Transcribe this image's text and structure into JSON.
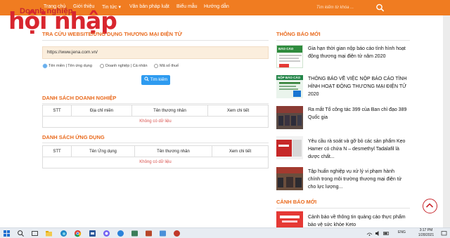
{
  "logo": {
    "tagline": "Doanh nghiệp",
    "name": "hội nhập"
  },
  "nav": {
    "items": [
      "Trang chủ",
      "Giới thiệu",
      "Tin tức",
      "Văn bản pháp luật",
      "Biểu mẫu",
      "Hướng dẫn"
    ],
    "tin_tuc_caret": "▾",
    "search_placeholder": "Tìm kiếm từ khóa ..."
  },
  "lookup": {
    "title": "TRA CỨU WEBSITE/ỨNG DỤNG THƯƠNG MẠI ĐIỆN TỬ",
    "url_value": "https://www.jena.com.vn/",
    "radios": [
      {
        "label": "Tên miền | Tên ứng dụng",
        "checked": true
      },
      {
        "label": "Doanh nghiệp | Cá nhân",
        "checked": false
      },
      {
        "label": "Mã số thuế",
        "checked": false
      }
    ],
    "search_button": "Tìm kiếm"
  },
  "enterprises": {
    "title": "DANH SÁCH DOANH NGHIỆP",
    "columns": [
      "STT",
      "Địa chỉ miền",
      "Tên thương nhân",
      "Xem chi tiết"
    ],
    "empty": "Không có dữ liệu"
  },
  "apps": {
    "title": "DANH SÁCH ỨNG DỤNG",
    "columns": [
      "STT",
      "Tên Ứng dụng",
      "Tên thương nhân",
      "Xem chi tiết"
    ],
    "empty": "Không có dữ liệu"
  },
  "sidebar": {
    "notices_title": "THÔNG BÁO MỚI",
    "news": [
      "Gia hạn thời gian nộp báo cáo tình hình hoạt động thương mại điện tử năm 2020",
      "THÔNG BÁO VỀ VIỆC NỘP BÁO CÁO TÌNH HÌNH HOẠT ĐỘNG THƯƠNG MẠI ĐIỆN TỬ 2020",
      "Ra mắt Tổ công tác 399 của Ban chỉ đạo 389 Quốc gia",
      "Yêu cầu rà soát và gỡ bỏ các sản phẩm Kẹo Hamer có chứa N – desmethyl Tadalafil là dược chất...",
      "Tập huấn nghiệp vụ xử lý vi phạm hành chính trong môi trường thương mại điện tử cho lực lượng..."
    ],
    "thumb_labels": [
      "BÁO CÁO",
      "NỘP BÁO CÁO",
      "",
      "",
      ""
    ],
    "warnings_title": "CẢNH BÁO MỚI",
    "warning_text": "Cảnh báo về thông tin quảng cáo thực phẩm bảo vệ sức khỏe Keto"
  },
  "taskbar": {
    "lang": "ENG",
    "time": "3:17 PM",
    "date": "1/28/2021"
  },
  "colors": {
    "nav_bg": "#f07c21",
    "accent": "#e96a1d",
    "brand_red": "#d8262e",
    "button_blue": "#2e9bf0",
    "empty_red": "#d9534f"
  }
}
